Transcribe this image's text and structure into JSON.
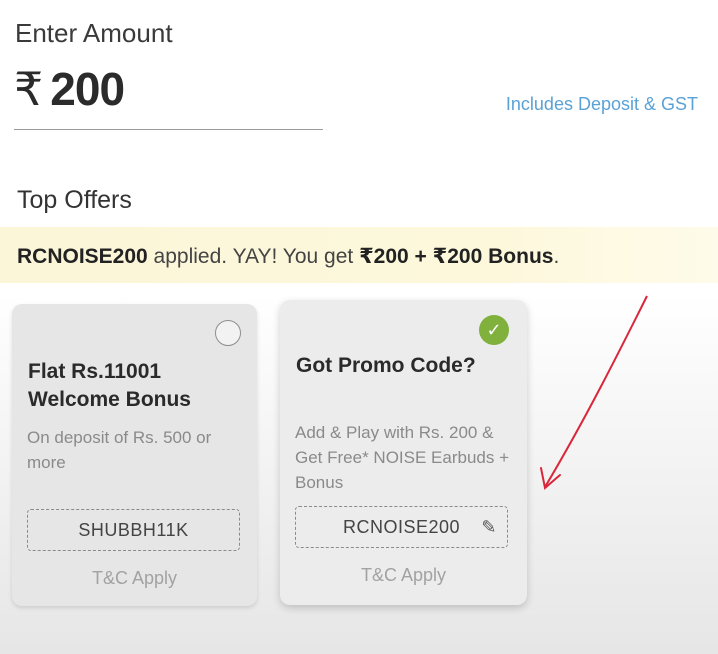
{
  "amount": {
    "label": "Enter Amount",
    "currency_symbol": "₹",
    "value": "200",
    "includes_text": "Includes Deposit & GST"
  },
  "offers": {
    "heading": "Top Offers",
    "applied_banner": {
      "code": "RCNOISE200",
      "text_middle": " applied. YAY! You get ",
      "reward": "₹200 + ₹200 Bonus",
      "end": "."
    },
    "cards": [
      {
        "title": "Flat Rs.11001 Welcome Bonus",
        "description": "On deposit of Rs. 500 or more",
        "code": "SHUBBH11K",
        "tnc": "T&C Apply",
        "selected": false
      },
      {
        "title": "Got Promo Code?",
        "description": "Add & Play with Rs. 200 & Get Free* NOISE Earbuds + Bonus",
        "code": "RCNOISE200",
        "tnc": "T&C Apply",
        "selected": true
      }
    ]
  },
  "colors": {
    "accent_blue": "#5aa2d6",
    "check_green": "#7fb13c",
    "banner_yellow": "#fbf6d8",
    "annotation_red": "#d9263a"
  }
}
